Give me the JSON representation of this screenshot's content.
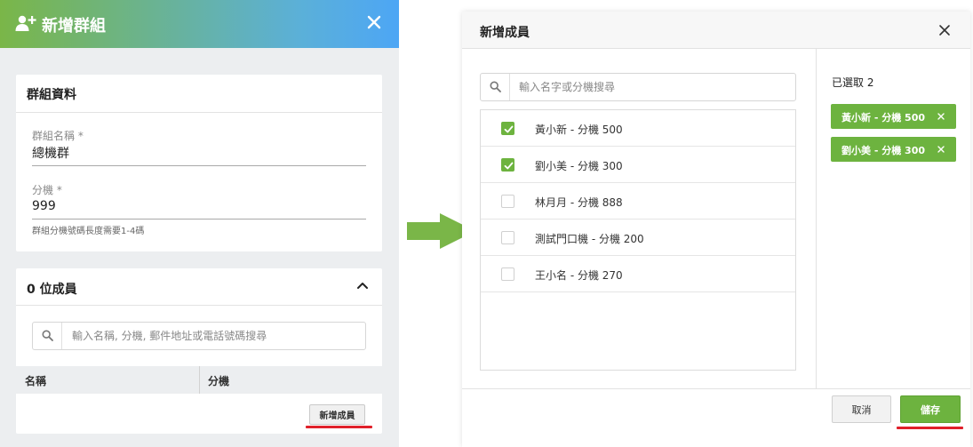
{
  "left_panel": {
    "header": {
      "icon": "add-user-icon",
      "title": "新增群組",
      "close_icon": "close-icon"
    },
    "group_info": {
      "title": "群組資料",
      "name_label": "群組名稱 *",
      "name_value": "總機群",
      "ext_label": "分機 *",
      "ext_value": "999",
      "ext_hint": "群組分機號碼長度需要1-4碼"
    },
    "members": {
      "title": "0 位成員",
      "collapse_icon": "chevron-up-icon",
      "search_placeholder": "輸入名稱, 分機, 郵件地址或電話號碼搜尋",
      "columns": [
        "名稱",
        "分機"
      ],
      "add_button": "新增成員"
    }
  },
  "arrow_icon": "arrow-right-icon",
  "dialog": {
    "title": "新增成員",
    "close_icon": "close-icon",
    "search_placeholder": "輸入名字或分機搜尋",
    "members": [
      {
        "label": "黃小新 - 分機 500",
        "checked": true
      },
      {
        "label": "劉小美 - 分機 300",
        "checked": true
      },
      {
        "label": "林月月 - 分機 888",
        "checked": false
      },
      {
        "label": "測試門口機 - 分機 200",
        "checked": false
      },
      {
        "label": "王小名 - 分機 270",
        "checked": false
      }
    ],
    "selected_title": "已選取 2",
    "selected_chips": [
      "黃小新 - 分機 500",
      "劉小美 - 分機 300"
    ],
    "cancel_button": "取消",
    "save_button": "儲存"
  },
  "colors": {
    "accent_green": "#6db33f",
    "header_gradient_start": "#7ab648",
    "header_gradient_end": "#4da6f5",
    "highlight_red": "#e0202a"
  }
}
